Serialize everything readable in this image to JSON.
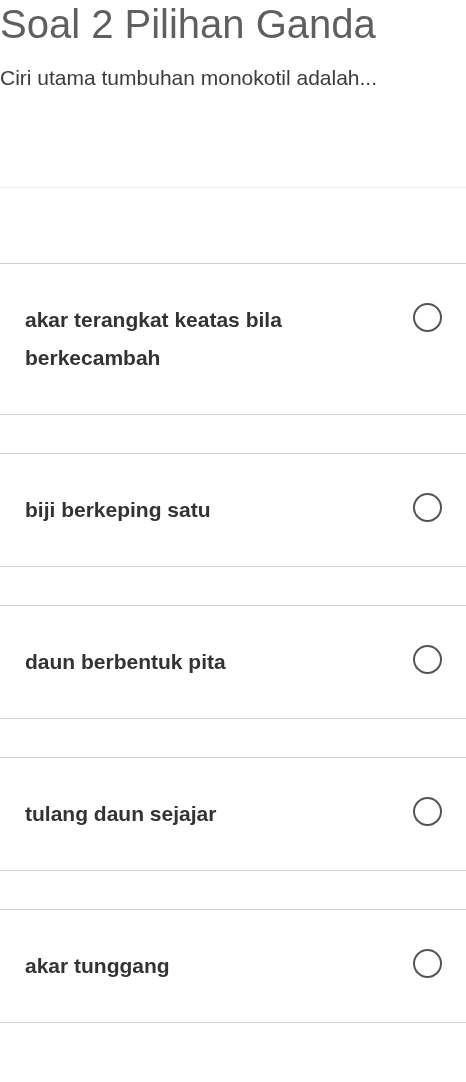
{
  "title": "Soal 2 Pilihan Ganda",
  "question": "Ciri utama tumbuhan monokotil adalah...",
  "options": [
    {
      "label": "akar terangkat keatas bila berkecambah",
      "selected": false
    },
    {
      "label": "biji berkeping satu",
      "selected": false
    },
    {
      "label": "daun berbentuk pita",
      "selected": false
    },
    {
      "label": "tulang daun sejajar",
      "selected": false
    },
    {
      "label": "akar tunggang",
      "selected": false
    }
  ]
}
